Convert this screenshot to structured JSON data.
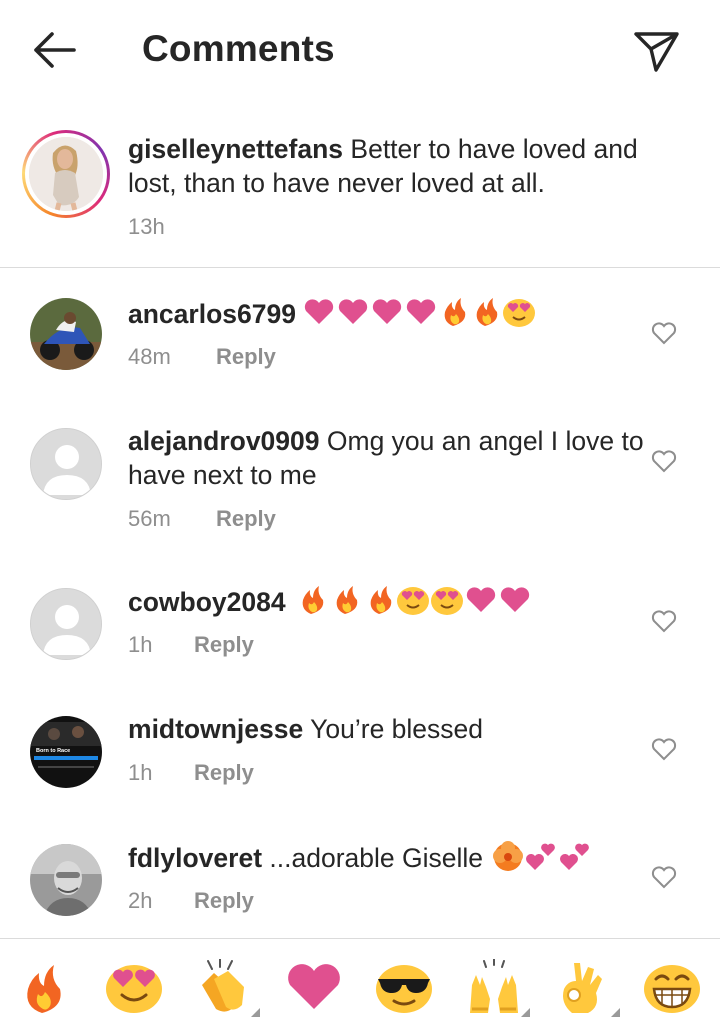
{
  "header": {
    "title": "Comments"
  },
  "caption": {
    "username": "giselleynettefans",
    "text": "Better to have loved and lost, than to have never loved at all.",
    "time": "13h"
  },
  "comments": [
    {
      "username": "ancarlos6799",
      "text": "",
      "time": "48m",
      "reply": "Reply",
      "emojis": [
        "heart",
        "heart",
        "heart",
        "heart",
        "fire",
        "fire",
        "heart-eyes"
      ]
    },
    {
      "username": "alejandrov0909",
      "text": "Omg you an angel I love to have next to me",
      "time": "56m",
      "reply": "Reply",
      "emojis": []
    },
    {
      "username": "cowboy2084",
      "text": "",
      "time": "1h",
      "reply": "Reply",
      "emojis": [
        "fire",
        "fire",
        "fire",
        "heart-eyes",
        "heart-eyes",
        "heart",
        "heart"
      ]
    },
    {
      "username": "midtownjesse",
      "text": "You’re blessed",
      "time": "1h",
      "reply": "Reply",
      "emojis": []
    },
    {
      "username": "fdlyloveret",
      "text": "...adorable Giselle",
      "time": "2h",
      "reply": "Reply",
      "emojis": [
        "hibiscus",
        "two-hearts",
        "two-hearts"
      ]
    }
  ],
  "avatar_thumb": {
    "title": "Born to Race"
  },
  "emoji_bar": [
    "fire",
    "heart-eyes",
    "clapping-hands",
    "heart",
    "sunglasses",
    "raised-hands",
    "ok-hand",
    "grinning"
  ],
  "colors": {
    "text": "#262626",
    "muted": "#8e8e8e",
    "divider": "#dbdbdb",
    "heart": "#e0508f",
    "emoji_yellow": "#ffc83d"
  }
}
